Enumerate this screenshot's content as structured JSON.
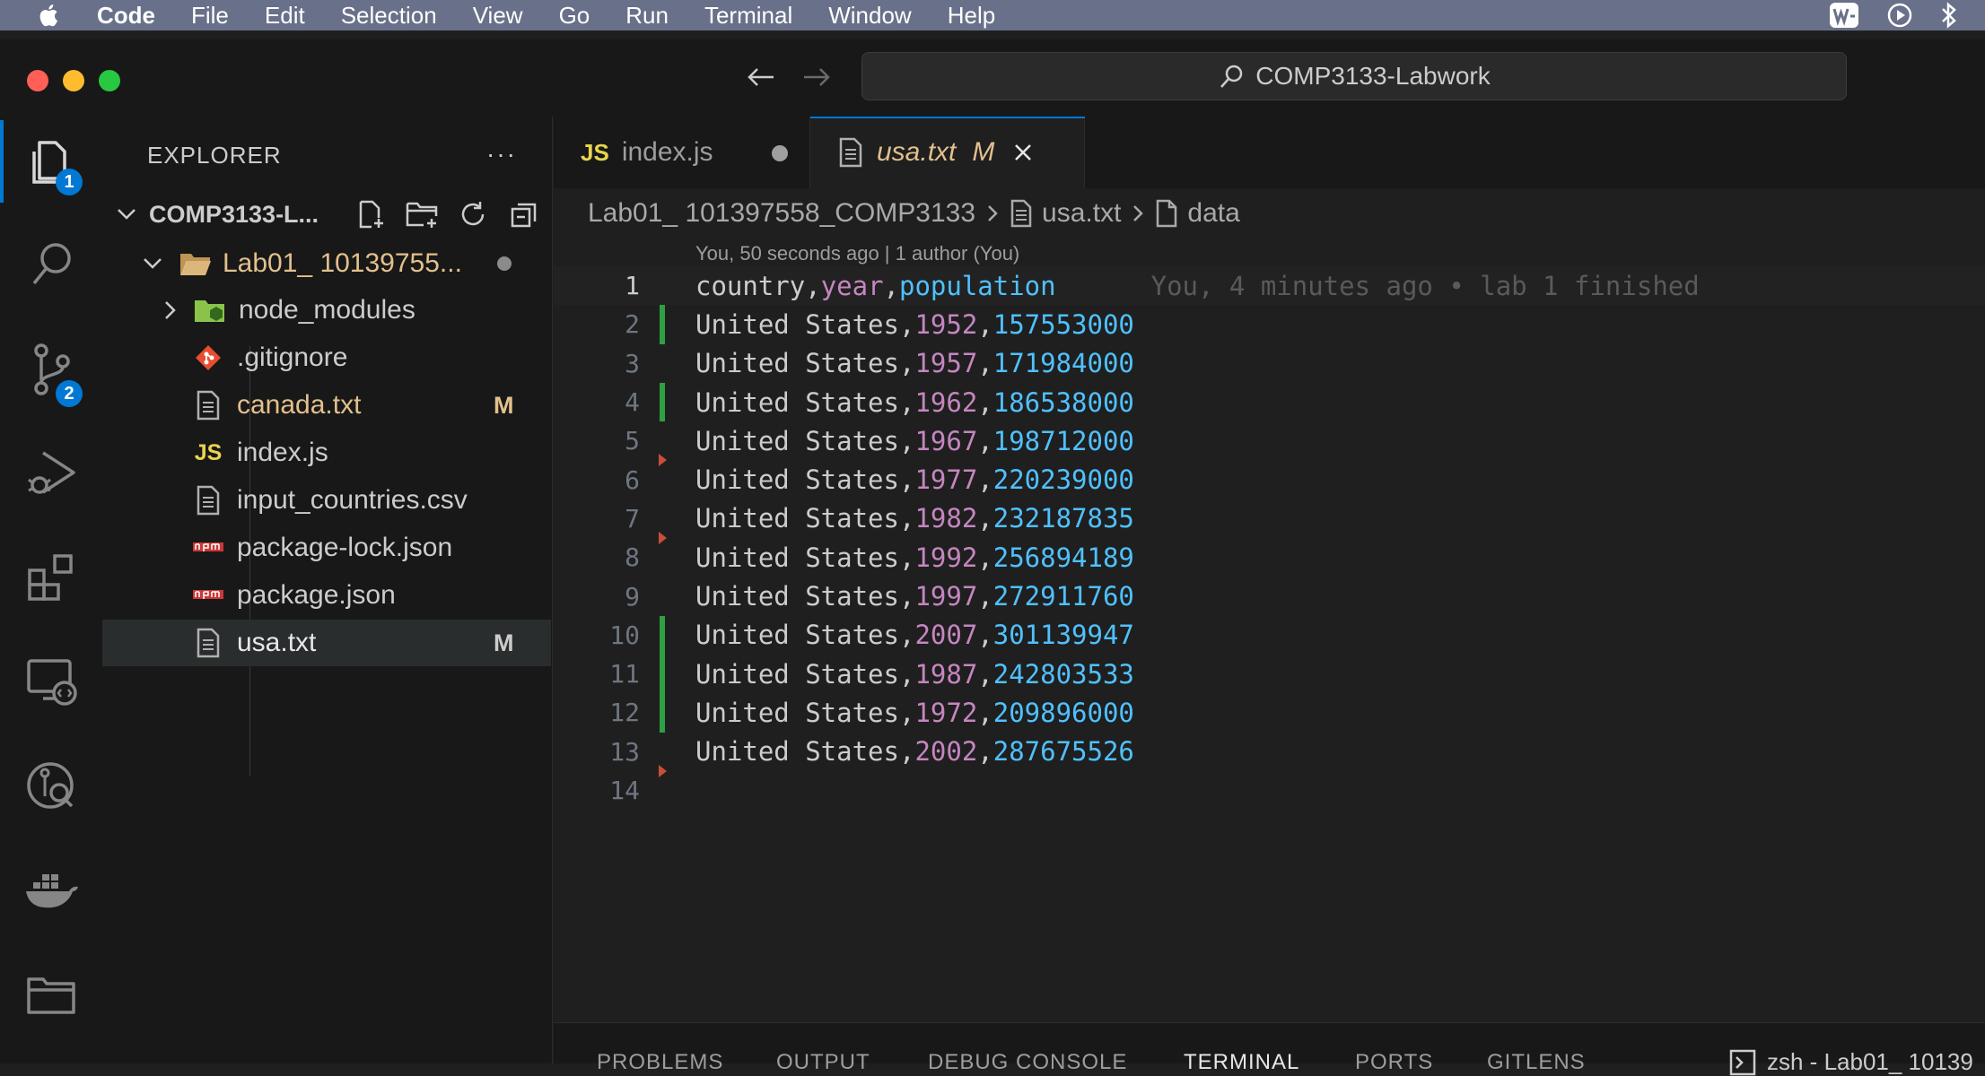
{
  "menubar": {
    "app_name": "Code",
    "items": [
      "File",
      "Edit",
      "Selection",
      "View",
      "Go",
      "Run",
      "Terminal",
      "Window",
      "Help"
    ]
  },
  "command_center": {
    "text": "COMP3133-Labwork"
  },
  "activity_bar": {
    "explorer_badge": "1",
    "source_control_badge": "2"
  },
  "explorer": {
    "title": "EXPLORER",
    "more": "···",
    "workspace": "COMP3133-L...",
    "folder": "Lab01_ 10139755...",
    "items": [
      {
        "label": "node_modules",
        "badge": ""
      },
      {
        "label": ".gitignore",
        "badge": ""
      },
      {
        "label": "canada.txt",
        "badge": "M"
      },
      {
        "label": "index.js",
        "badge": ""
      },
      {
        "label": "input_countries.csv",
        "badge": ""
      },
      {
        "label": "package-lock.json",
        "badge": ""
      },
      {
        "label": "package.json",
        "badge": ""
      },
      {
        "label": "usa.txt",
        "badge": "M"
      }
    ]
  },
  "tabs": [
    {
      "icon": "JS",
      "label": "index.js"
    },
    {
      "label": "usa.txt",
      "status": "M"
    }
  ],
  "breadcrumb": [
    "Lab01_ 101397558_COMP3133",
    "usa.txt",
    "data"
  ],
  "blame_header": "You, 50 seconds ago | 1 author (You)",
  "inline_blame": "You, 4 minutes ago • lab 1 finished",
  "code": {
    "header": {
      "num": "1",
      "country": "country,",
      "year": "year",
      "comma": ",",
      "population": "population"
    },
    "rows": [
      {
        "num": "2",
        "country": "United States,",
        "year": "1952",
        "comma": ",",
        "population": "157553000"
      },
      {
        "num": "3",
        "country": "United States,",
        "year": "1957",
        "comma": ",",
        "population": "171984000"
      },
      {
        "num": "4",
        "country": "United States,",
        "year": "1962",
        "comma": ",",
        "population": "186538000"
      },
      {
        "num": "5",
        "country": "United States,",
        "year": "1967",
        "comma": ",",
        "population": "198712000"
      },
      {
        "num": "6",
        "country": "United States,",
        "year": "1977",
        "comma": ",",
        "population": "220239000"
      },
      {
        "num": "7",
        "country": "United States,",
        "year": "1982",
        "comma": ",",
        "population": "232187835"
      },
      {
        "num": "8",
        "country": "United States,",
        "year": "1992",
        "comma": ",",
        "population": "256894189"
      },
      {
        "num": "9",
        "country": "United States,",
        "year": "1997",
        "comma": ",",
        "population": "272911760"
      },
      {
        "num": "10",
        "country": "United States,",
        "year": "2007",
        "comma": ",",
        "population": "301139947"
      },
      {
        "num": "11",
        "country": "United States,",
        "year": "1987",
        "comma": ",",
        "population": "242803533"
      },
      {
        "num": "12",
        "country": "United States,",
        "year": "1972",
        "comma": ",",
        "population": "209896000"
      },
      {
        "num": "13",
        "country": "United States,",
        "year": "2002",
        "comma": ",",
        "population": "287675526"
      }
    ],
    "last": {
      "num": "14"
    }
  },
  "panel": {
    "tabs": [
      "PROBLEMS",
      "OUTPUT",
      "DEBUG CONSOLE",
      "TERMINAL",
      "PORTS",
      "GITLENS"
    ],
    "terminal_name": "zsh - Lab01_ 10139"
  },
  "colors": {
    "accent": "#0078d4",
    "modified": "#e2c08d",
    "added_gutter": "#2ea043",
    "year": "#c586c0",
    "population": "#4fc1ff"
  }
}
